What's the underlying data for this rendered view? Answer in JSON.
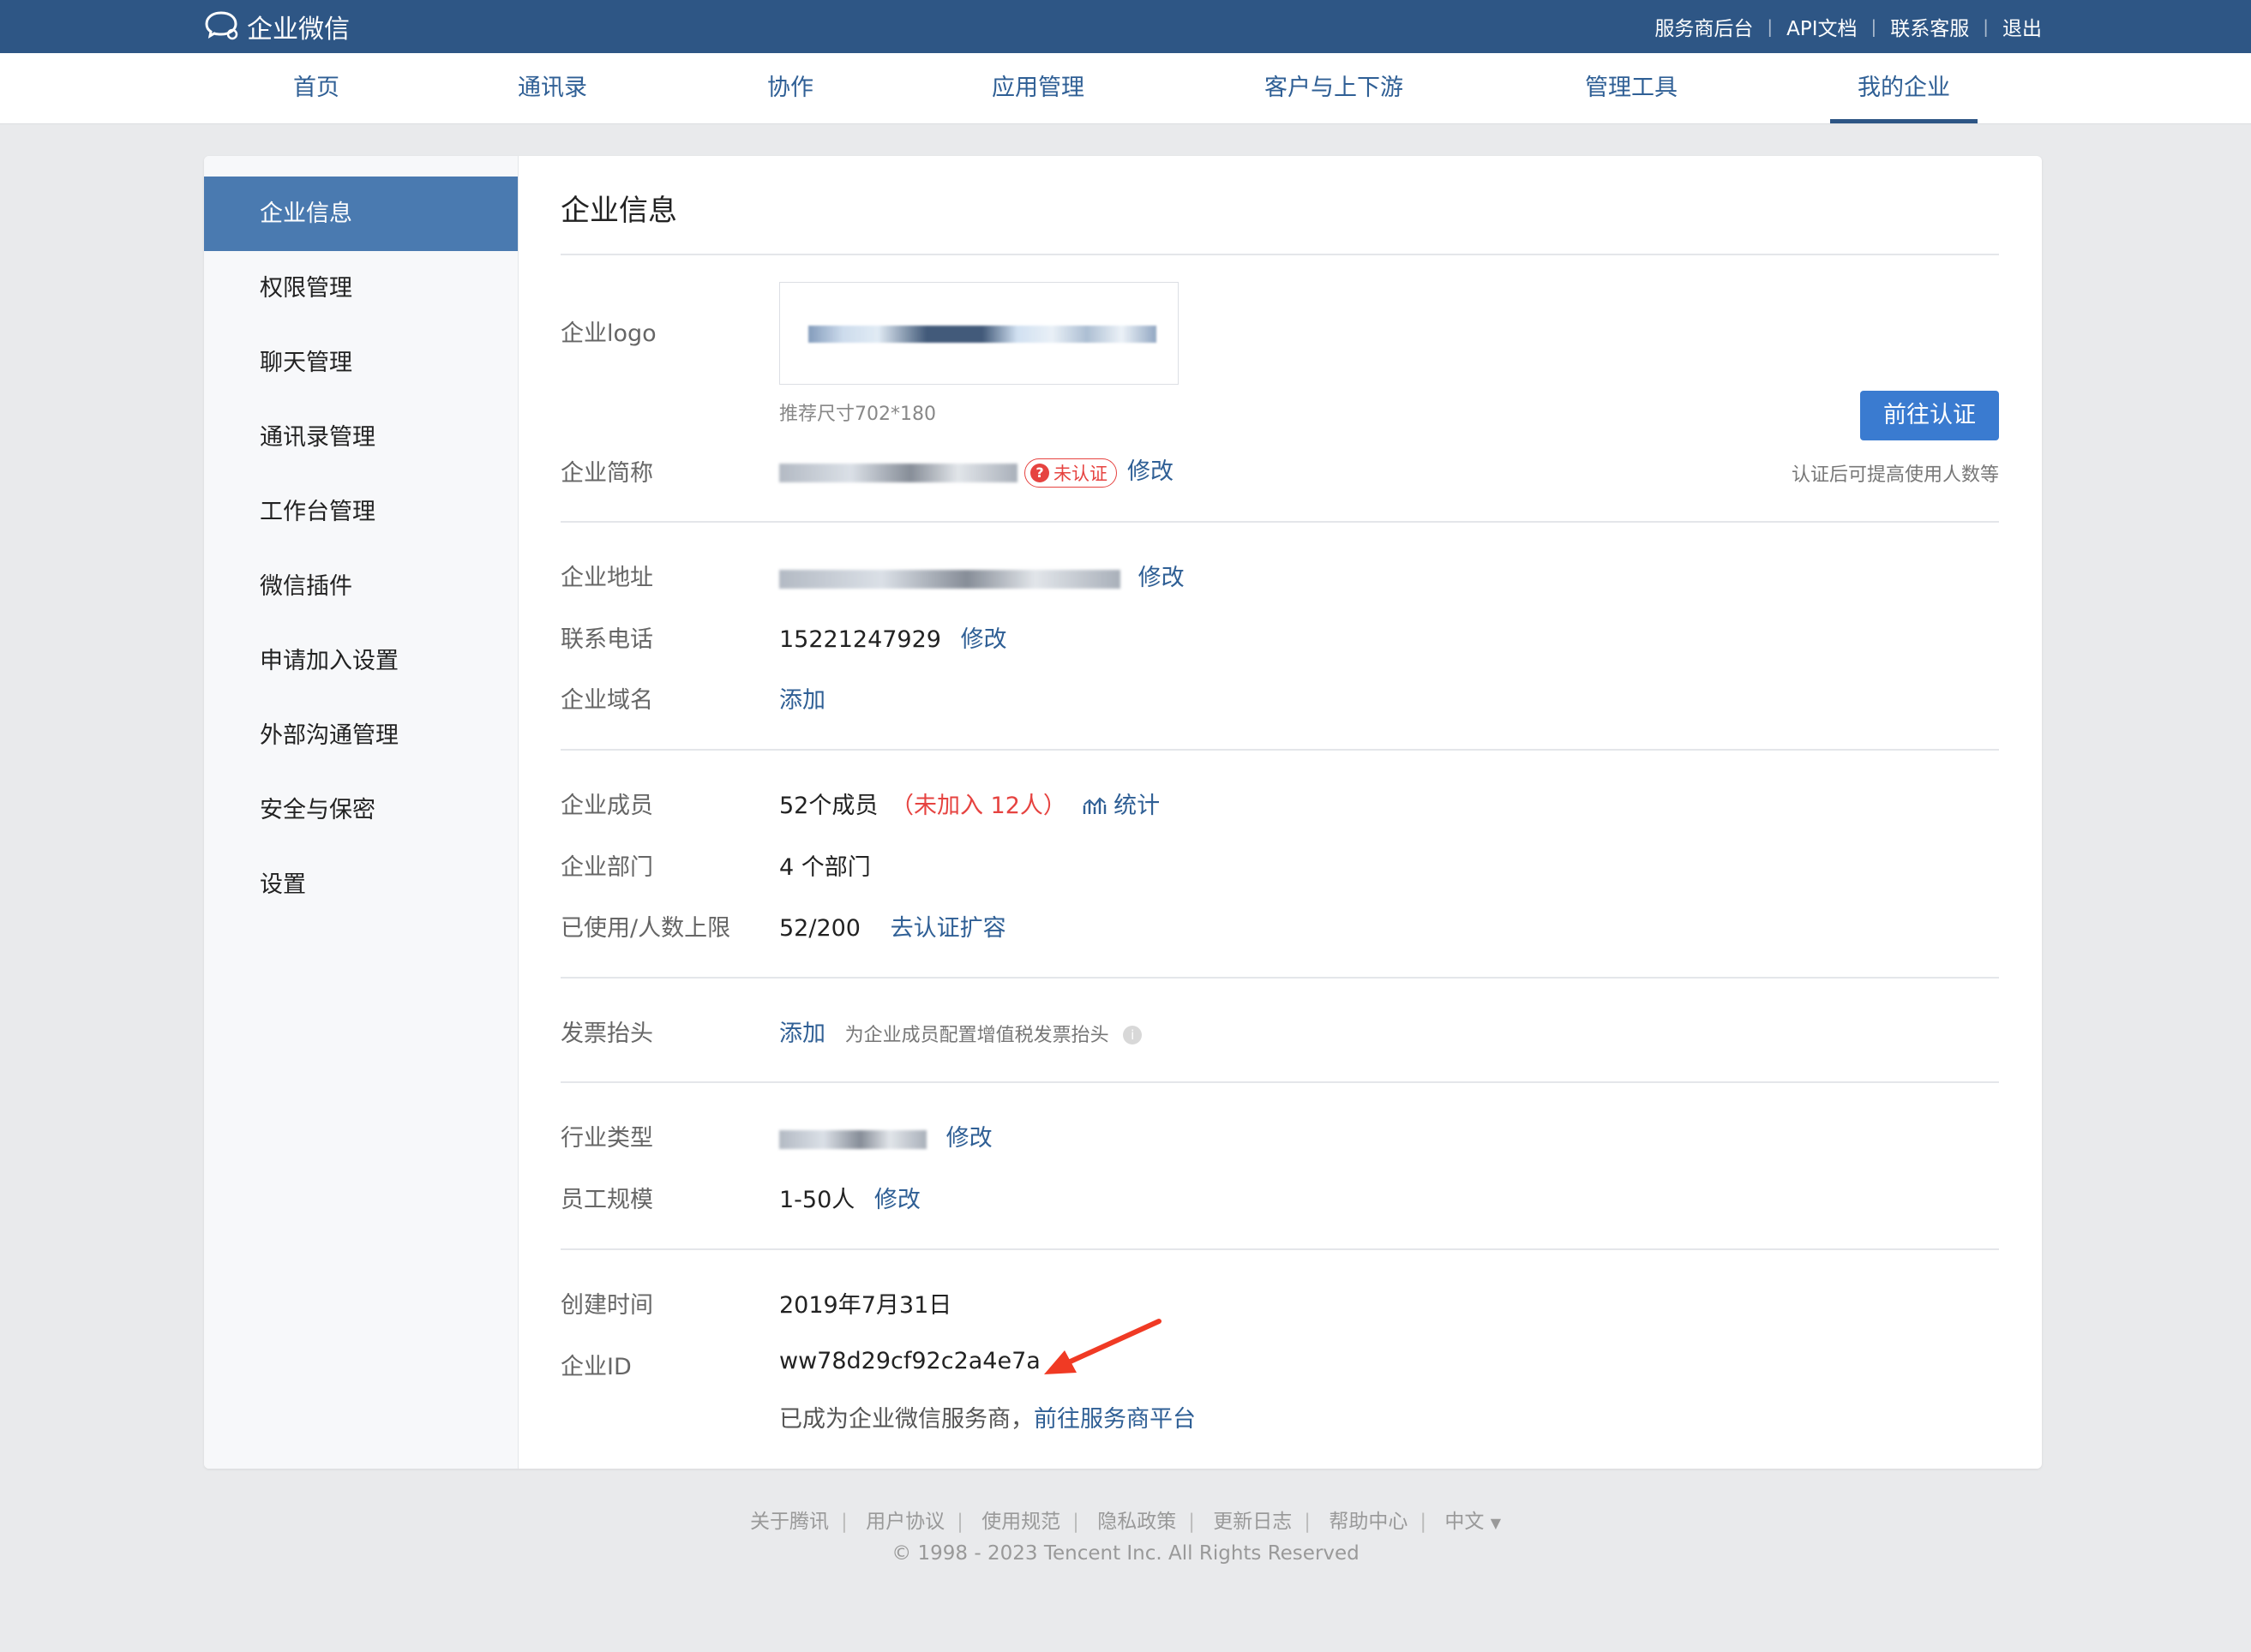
{
  "app": {
    "name": "企业微信"
  },
  "top_links": [
    "服务商后台",
    "API文档",
    "联系客服",
    "退出"
  ],
  "nav": {
    "items": [
      "首页",
      "通讯录",
      "协作",
      "应用管理",
      "客户与上下游",
      "管理工具",
      "我的企业"
    ],
    "active": "我的企业"
  },
  "sidebar": {
    "items": [
      "企业信息",
      "权限管理",
      "聊天管理",
      "通讯录管理",
      "工作台管理",
      "微信插件",
      "申请加入设置",
      "外部沟通管理",
      "安全与保密",
      "设置"
    ],
    "active": "企业信息"
  },
  "main": {
    "title": "企业信息",
    "logo_label": "企业logo",
    "logo_hint": "推荐尺寸702*180",
    "cert_button": "前往认证",
    "cert_note": "认证后可提高使用人数等",
    "short_name": {
      "label": "企业简称",
      "badge": "未认证",
      "badge_icon": "?",
      "action": "修改"
    },
    "address": {
      "label": "企业地址",
      "action": "修改"
    },
    "phone": {
      "label": "联系电话",
      "value": "15221247929",
      "action": "修改"
    },
    "domain": {
      "label": "企业域名",
      "action": "添加"
    },
    "members": {
      "label": "企业成员",
      "value": "52个成员",
      "pending": "（未加入 12人）",
      "stats": "统计"
    },
    "departments": {
      "label": "企业部门",
      "value": "4 个部门"
    },
    "usage": {
      "label": "已使用/人数上限",
      "value": "52/200",
      "action": "去认证扩容"
    },
    "invoice": {
      "label": "发票抬头",
      "action": "添加",
      "hint": "为企业成员配置增值税发票抬头"
    },
    "industry": {
      "label": "行业类型",
      "action": "修改"
    },
    "scale": {
      "label": "员工规模",
      "value": "1-50人",
      "action": "修改"
    },
    "created": {
      "label": "创建时间",
      "value": "2019年7月31日"
    },
    "corp_id": {
      "label": "企业ID",
      "value": "ww78d29cf92c2a4e7a"
    },
    "provider": {
      "text": "已成为企业微信服务商，",
      "link": "前往服务商平台"
    }
  },
  "footer": {
    "links": [
      "关于腾讯",
      "用户协议",
      "使用规范",
      "隐私政策",
      "更新日志",
      "帮助中心",
      "中文"
    ],
    "copyright": "© 1998 - 2023 Tencent Inc. All Rights Reserved"
  },
  "colors": {
    "topbar": "#2e5685",
    "accent": "#2f5f95",
    "sidebar_active": "#4a7ab0",
    "danger": "#e64340",
    "button": "#3a7bd0"
  }
}
